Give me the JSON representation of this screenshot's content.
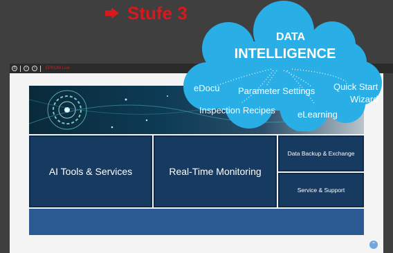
{
  "heading": {
    "text": "Stufe 3",
    "color": "#d7191d"
  },
  "window": {
    "title": "EPROM Live",
    "controls": [
      "menu-icon",
      "back-icon",
      "forward-icon"
    ]
  },
  "cloud": {
    "title_line1": "DATA",
    "title_line2": "INTELLIGENCE",
    "items": {
      "edocu": "eDocu",
      "parameter_settings": "Parameter Settings",
      "quick_start_line1": "Quick Start",
      "quick_start_line2": "Wizard",
      "inspection_recipes": "Inspection Recipes",
      "elearning": "eLearning"
    },
    "color": "#29aee6"
  },
  "tiles": {
    "ai_tools": "AI Tools & Services",
    "realtime_monitoring": "Real-Time Monitoring",
    "data_backup": "Data Backup & Exchange",
    "service_support": "Service & Support"
  },
  "colors": {
    "tile": "#163a60",
    "bar": "#2b5a93",
    "background": "#3f3f3f"
  }
}
